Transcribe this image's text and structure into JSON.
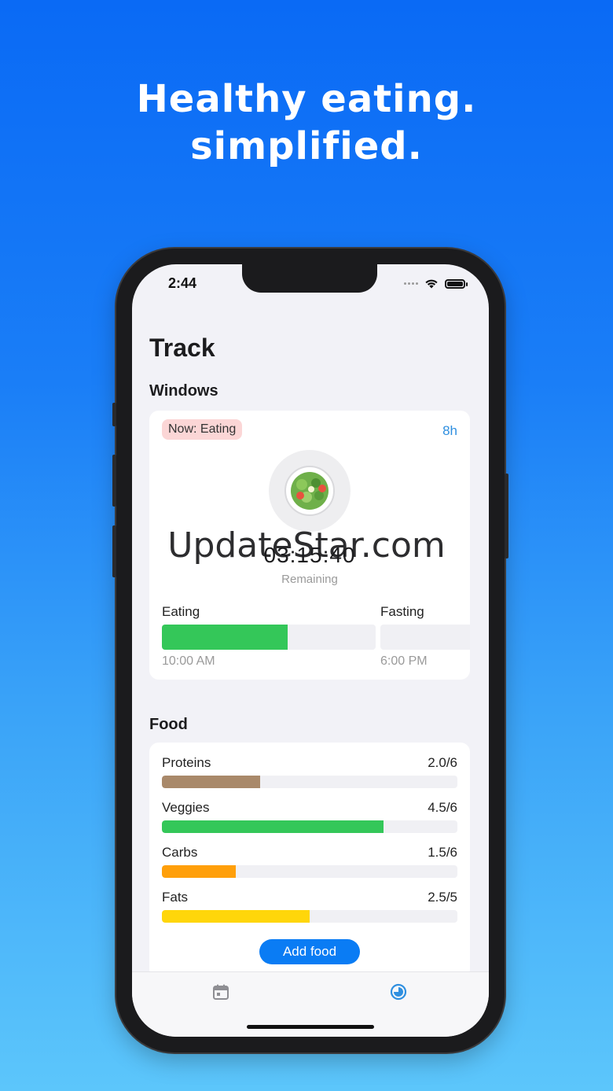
{
  "headline": {
    "line1": "Healthy eating.",
    "line2": "simplified."
  },
  "status_bar": {
    "time": "2:44"
  },
  "page_title": "Track",
  "windows": {
    "section_title": "Windows",
    "status_badge": "Now: Eating",
    "duration": "8h",
    "timer": "03:15:40",
    "timer_caption": "Remaining",
    "eating": {
      "label": "Eating",
      "start": "10:00 AM",
      "progress": 0.59
    },
    "fasting": {
      "label": "Fasting",
      "start": "6:00 PM"
    }
  },
  "watermark": "UpdateStar.com",
  "food": {
    "section_title": "Food",
    "items": [
      {
        "name": "Proteins",
        "value": "2.0/6",
        "fraction": 0.333,
        "color": "#a9896a"
      },
      {
        "name": "Veggies",
        "value": "4.5/6",
        "fraction": 0.75,
        "color": "#34c759"
      },
      {
        "name": "Carbs",
        "value": "1.5/6",
        "fraction": 0.25,
        "color": "#ff9f0a"
      },
      {
        "name": "Fats",
        "value": "2.5/5",
        "fraction": 0.5,
        "color": "#ffd60a"
      }
    ],
    "add_button": "Add food"
  },
  "tabbar": {
    "tabs": [
      {
        "icon": "calendar-icon",
        "active": false
      },
      {
        "icon": "clock-icon",
        "active": true
      }
    ],
    "active_color": "#2f8fe0",
    "inactive_color": "#8e8e93"
  }
}
